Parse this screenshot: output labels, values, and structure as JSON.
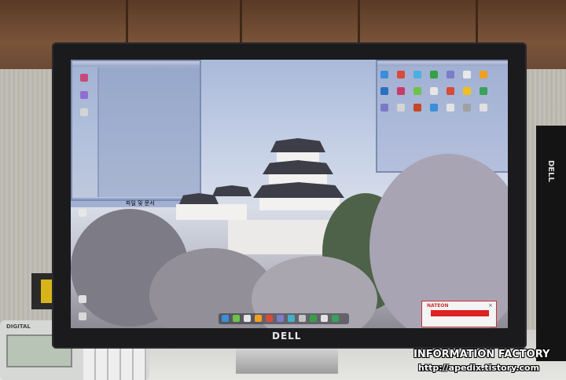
{
  "monitor": {
    "brand": "DELL"
  },
  "side_monitor": {
    "brand": "DELL"
  },
  "phone": {
    "brand": "DIGITAL"
  },
  "desktop": {
    "window_label": "파일 및 문서",
    "popup_brand": "NATEON",
    "taskbar_icon_colors": [
      "#3a8fd8",
      "#6fc24b",
      "#e6e6e6",
      "#f0a020",
      "#d84b3a",
      "#7c7cc8",
      "#45b0c8",
      "#c4c4c4",
      "#36a046",
      "#e3e3e3",
      "#3aa05a"
    ]
  },
  "watermark": {
    "title": "INFORMATION FACTORY",
    "url": "http://apedix.tistory.com"
  }
}
